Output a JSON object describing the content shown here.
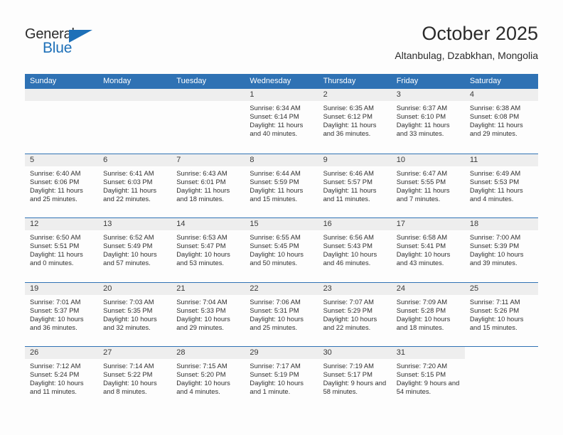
{
  "logo": {
    "word_one": "General",
    "word_two": "Blue",
    "triangle_icon": "blue-triangle-icon",
    "accent_color": "#1d70b8"
  },
  "header": {
    "title": "October 2025",
    "subtitle": "Altanbulag, Dzabkhan, Mongolia"
  },
  "theme": {
    "header_blue": "#2f72b4",
    "day_band_gray": "#eeeeee",
    "text_dark": "#2b2b2b"
  },
  "weekdays": [
    "Sunday",
    "Monday",
    "Tuesday",
    "Wednesday",
    "Thursday",
    "Friday",
    "Saturday"
  ],
  "weeks": [
    [
      {
        "day": "",
        "sunrise": "",
        "sunset": "",
        "daylight": "",
        "empty": true
      },
      {
        "day": "",
        "sunrise": "",
        "sunset": "",
        "daylight": "",
        "empty": true
      },
      {
        "day": "",
        "sunrise": "",
        "sunset": "",
        "daylight": "",
        "empty": true
      },
      {
        "day": "1",
        "sunrise": "Sunrise: 6:34 AM",
        "sunset": "Sunset: 6:14 PM",
        "daylight": "Daylight: 11 hours and 40 minutes."
      },
      {
        "day": "2",
        "sunrise": "Sunrise: 6:35 AM",
        "sunset": "Sunset: 6:12 PM",
        "daylight": "Daylight: 11 hours and 36 minutes."
      },
      {
        "day": "3",
        "sunrise": "Sunrise: 6:37 AM",
        "sunset": "Sunset: 6:10 PM",
        "daylight": "Daylight: 11 hours and 33 minutes."
      },
      {
        "day": "4",
        "sunrise": "Sunrise: 6:38 AM",
        "sunset": "Sunset: 6:08 PM",
        "daylight": "Daylight: 11 hours and 29 minutes."
      }
    ],
    [
      {
        "day": "5",
        "sunrise": "Sunrise: 6:40 AM",
        "sunset": "Sunset: 6:06 PM",
        "daylight": "Daylight: 11 hours and 25 minutes."
      },
      {
        "day": "6",
        "sunrise": "Sunrise: 6:41 AM",
        "sunset": "Sunset: 6:03 PM",
        "daylight": "Daylight: 11 hours and 22 minutes."
      },
      {
        "day": "7",
        "sunrise": "Sunrise: 6:43 AM",
        "sunset": "Sunset: 6:01 PM",
        "daylight": "Daylight: 11 hours and 18 minutes."
      },
      {
        "day": "8",
        "sunrise": "Sunrise: 6:44 AM",
        "sunset": "Sunset: 5:59 PM",
        "daylight": "Daylight: 11 hours and 15 minutes."
      },
      {
        "day": "9",
        "sunrise": "Sunrise: 6:46 AM",
        "sunset": "Sunset: 5:57 PM",
        "daylight": "Daylight: 11 hours and 11 minutes."
      },
      {
        "day": "10",
        "sunrise": "Sunrise: 6:47 AM",
        "sunset": "Sunset: 5:55 PM",
        "daylight": "Daylight: 11 hours and 7 minutes."
      },
      {
        "day": "11",
        "sunrise": "Sunrise: 6:49 AM",
        "sunset": "Sunset: 5:53 PM",
        "daylight": "Daylight: 11 hours and 4 minutes."
      }
    ],
    [
      {
        "day": "12",
        "sunrise": "Sunrise: 6:50 AM",
        "sunset": "Sunset: 5:51 PM",
        "daylight": "Daylight: 11 hours and 0 minutes."
      },
      {
        "day": "13",
        "sunrise": "Sunrise: 6:52 AM",
        "sunset": "Sunset: 5:49 PM",
        "daylight": "Daylight: 10 hours and 57 minutes."
      },
      {
        "day": "14",
        "sunrise": "Sunrise: 6:53 AM",
        "sunset": "Sunset: 5:47 PM",
        "daylight": "Daylight: 10 hours and 53 minutes."
      },
      {
        "day": "15",
        "sunrise": "Sunrise: 6:55 AM",
        "sunset": "Sunset: 5:45 PM",
        "daylight": "Daylight: 10 hours and 50 minutes."
      },
      {
        "day": "16",
        "sunrise": "Sunrise: 6:56 AM",
        "sunset": "Sunset: 5:43 PM",
        "daylight": "Daylight: 10 hours and 46 minutes."
      },
      {
        "day": "17",
        "sunrise": "Sunrise: 6:58 AM",
        "sunset": "Sunset: 5:41 PM",
        "daylight": "Daylight: 10 hours and 43 minutes."
      },
      {
        "day": "18",
        "sunrise": "Sunrise: 7:00 AM",
        "sunset": "Sunset: 5:39 PM",
        "daylight": "Daylight: 10 hours and 39 minutes."
      }
    ],
    [
      {
        "day": "19",
        "sunrise": "Sunrise: 7:01 AM",
        "sunset": "Sunset: 5:37 PM",
        "daylight": "Daylight: 10 hours and 36 minutes."
      },
      {
        "day": "20",
        "sunrise": "Sunrise: 7:03 AM",
        "sunset": "Sunset: 5:35 PM",
        "daylight": "Daylight: 10 hours and 32 minutes."
      },
      {
        "day": "21",
        "sunrise": "Sunrise: 7:04 AM",
        "sunset": "Sunset: 5:33 PM",
        "daylight": "Daylight: 10 hours and 29 minutes."
      },
      {
        "day": "22",
        "sunrise": "Sunrise: 7:06 AM",
        "sunset": "Sunset: 5:31 PM",
        "daylight": "Daylight: 10 hours and 25 minutes."
      },
      {
        "day": "23",
        "sunrise": "Sunrise: 7:07 AM",
        "sunset": "Sunset: 5:29 PM",
        "daylight": "Daylight: 10 hours and 22 minutes."
      },
      {
        "day": "24",
        "sunrise": "Sunrise: 7:09 AM",
        "sunset": "Sunset: 5:28 PM",
        "daylight": "Daylight: 10 hours and 18 minutes."
      },
      {
        "day": "25",
        "sunrise": "Sunrise: 7:11 AM",
        "sunset": "Sunset: 5:26 PM",
        "daylight": "Daylight: 10 hours and 15 minutes."
      }
    ],
    [
      {
        "day": "26",
        "sunrise": "Sunrise: 7:12 AM",
        "sunset": "Sunset: 5:24 PM",
        "daylight": "Daylight: 10 hours and 11 minutes."
      },
      {
        "day": "27",
        "sunrise": "Sunrise: 7:14 AM",
        "sunset": "Sunset: 5:22 PM",
        "daylight": "Daylight: 10 hours and 8 minutes."
      },
      {
        "day": "28",
        "sunrise": "Sunrise: 7:15 AM",
        "sunset": "Sunset: 5:20 PM",
        "daylight": "Daylight: 10 hours and 4 minutes."
      },
      {
        "day": "29",
        "sunrise": "Sunrise: 7:17 AM",
        "sunset": "Sunset: 5:19 PM",
        "daylight": "Daylight: 10 hours and 1 minute."
      },
      {
        "day": "30",
        "sunrise": "Sunrise: 7:19 AM",
        "sunset": "Sunset: 5:17 PM",
        "daylight": "Daylight: 9 hours and 58 minutes."
      },
      {
        "day": "31",
        "sunrise": "Sunrise: 7:20 AM",
        "sunset": "Sunset: 5:15 PM",
        "daylight": "Daylight: 9 hours and 54 minutes."
      },
      {
        "day": "",
        "sunrise": "",
        "sunset": "",
        "daylight": "",
        "empty": true,
        "noband": true
      }
    ]
  ]
}
